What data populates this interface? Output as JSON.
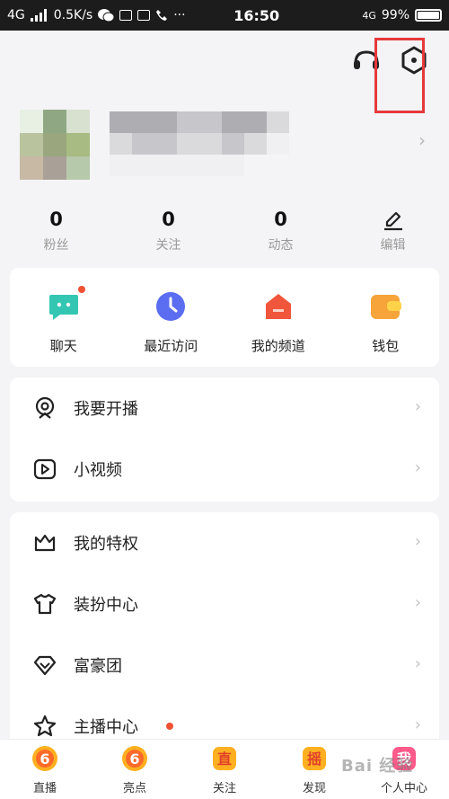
{
  "status_bar": {
    "network": "4G",
    "speed": "0.5K/s",
    "more": "···",
    "time": "16:50",
    "lte": "4G",
    "battery": "99%"
  },
  "stats": [
    {
      "value": "0",
      "label": "粉丝"
    },
    {
      "value": "0",
      "label": "关注"
    },
    {
      "value": "0",
      "label": "动态"
    },
    {
      "label": "编辑"
    }
  ],
  "shortcuts": [
    {
      "label": "聊天",
      "icon": "chat-bubble-icon",
      "color": "#33c7b3"
    },
    {
      "label": "最近访问",
      "icon": "clock-icon",
      "color": "#5b6df0"
    },
    {
      "label": "我的频道",
      "icon": "channel-home-icon",
      "color": "#f0563c"
    },
    {
      "label": "钱包",
      "icon": "wallet-icon",
      "color": "#f7a43a"
    }
  ],
  "menu_live": [
    {
      "label": "我要开播",
      "icon": "camera-icon"
    },
    {
      "label": "小视频",
      "icon": "play-video-icon"
    }
  ],
  "menu_more": [
    {
      "label": "我的特权",
      "icon": "crown-icon"
    },
    {
      "label": "装扮中心",
      "icon": "tshirt-icon"
    },
    {
      "label": "富豪团",
      "icon": "diamond-icon"
    },
    {
      "label": "主播中心",
      "icon": "star-icon"
    }
  ],
  "tabs": [
    {
      "label": "直播",
      "glyph": "6"
    },
    {
      "label": "亮点",
      "glyph": "6"
    },
    {
      "label": "关注",
      "glyph": "直"
    },
    {
      "label": "发现",
      "glyph": "摇"
    },
    {
      "label": "个人中心",
      "glyph": "我"
    }
  ],
  "watermark": "Bai 经验",
  "colors": {
    "accent_orange": "#f7a43a",
    "highlight_red": "#e4393c",
    "notification_dot": "#f05133"
  }
}
